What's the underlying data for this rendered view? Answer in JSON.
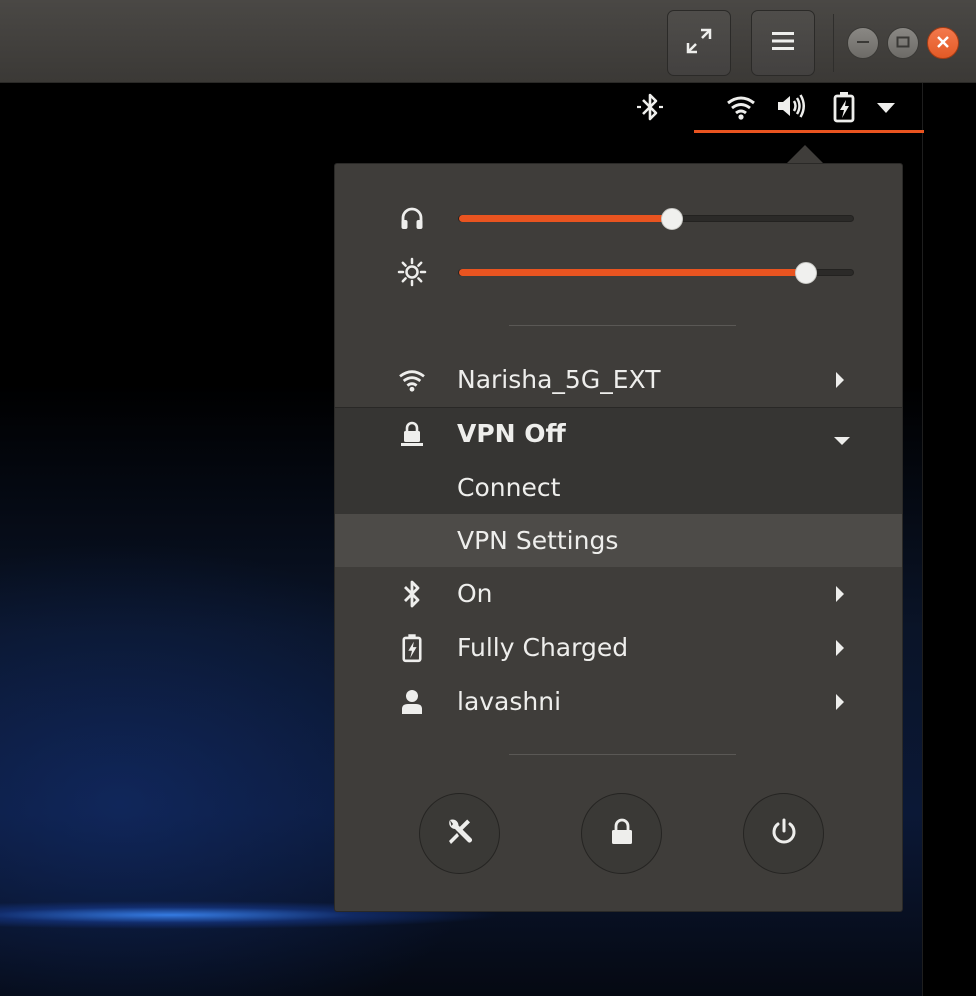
{
  "titlebar": {
    "icons": [
      "fullscreen-icon",
      "hamburger-menu-icon"
    ],
    "window_controls": [
      "minimize",
      "maximize",
      "close"
    ]
  },
  "panel": {
    "indicators": [
      "bluetooth-icon",
      "wifi-icon",
      "volume-icon",
      "battery-charged-icon",
      "dropdown-arrow-icon"
    ],
    "accent_color": "#e95420"
  },
  "menu": {
    "sliders": {
      "volume": {
        "icon": "headphones-icon",
        "level": 0.54
      },
      "brightness": {
        "icon": "brightness-icon",
        "level": 0.88
      }
    },
    "wifi": {
      "label": "Narisha_5G_EXT",
      "icon": "wifi-icon"
    },
    "vpn": {
      "label": "VPN Off",
      "icon": "vpn-icon",
      "submenu": {
        "connect": "Connect",
        "settings": "VPN Settings"
      }
    },
    "bluetooth": {
      "label": "On",
      "icon": "bluetooth-icon"
    },
    "battery": {
      "label": "Fully Charged",
      "icon": "battery-charged-icon"
    },
    "user": {
      "label": "lavashni",
      "icon": "user-icon"
    },
    "actions": [
      "settings-icon",
      "lock-icon",
      "power-icon"
    ],
    "colors": {
      "background": "#3f3d3a",
      "highlight": "#4d4b48",
      "text": "#eeeeec"
    }
  }
}
